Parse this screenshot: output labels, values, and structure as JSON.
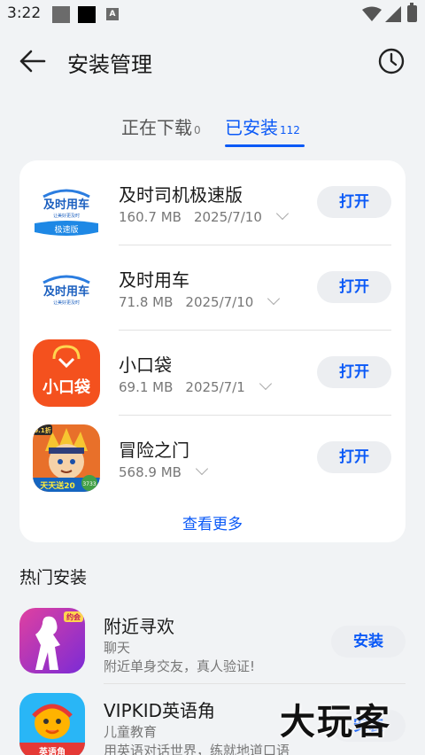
{
  "status_bar": {
    "time": "3:22",
    "notif_icon_letter": "A"
  },
  "header": {
    "title": "安装管理"
  },
  "tabs": [
    {
      "label": "正在下载",
      "count": "0"
    },
    {
      "label": "已安装",
      "count": "112"
    }
  ],
  "installed_apps": [
    {
      "name": "及时司机极速版",
      "size": "160.7 MB",
      "date": "2025/7/10",
      "button": "打开",
      "icon_text": "及时用车",
      "icon_sub": "让美好更及时",
      "icon_badge": "极速版"
    },
    {
      "name": "及时用车",
      "size": "71.8 MB",
      "date": "2025/7/10",
      "button": "打开",
      "icon_text": "及时用车",
      "icon_sub": "让美好更及时"
    },
    {
      "name": "小口袋",
      "size": "69.1 MB",
      "date": "2025/7/1",
      "button": "打开",
      "icon_text": "小口袋"
    },
    {
      "name": "冒险之门",
      "size": "568.9 MB",
      "date": "",
      "button": "打开",
      "icon_badge_top": "0.1折",
      "icon_bottom": "天天送20",
      "icon_bottom_right": "3733"
    }
  ],
  "see_more": "查看更多",
  "hot_section": {
    "title": "热门安装",
    "apps": [
      {
        "name": "附近寻欢",
        "category": "聊天",
        "desc": "附近单身交友，真人验证!",
        "button": "安装",
        "icon_badge": "约会"
      },
      {
        "name": "VIPKID英语角",
        "category": "儿童教育",
        "desc": "用英语对话世界，练就地道口语",
        "button": "安装",
        "icon_text": "英语角"
      }
    ]
  },
  "watermark": "大玩客",
  "colors": {
    "accent": "#0a59f7",
    "background": "#f1f3f5",
    "card": "#ffffff"
  }
}
